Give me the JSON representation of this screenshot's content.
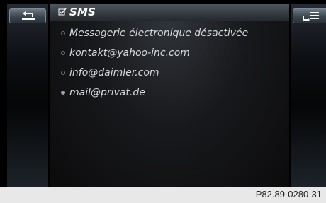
{
  "header": {
    "title": "SMS",
    "check_icon": "checkbox-checked-icon"
  },
  "left_button": {
    "icon": "back-arrow-icon"
  },
  "right_button": {
    "icon": "menu-submenu-icon"
  },
  "items": [
    {
      "label": "Messagerie électronique désactivée",
      "selected": false
    },
    {
      "label": "kontakt@yahoo-inc.com",
      "selected": false
    },
    {
      "label": "info@daimler.com",
      "selected": false
    },
    {
      "label": "mail@privat.de",
      "selected": true
    }
  ],
  "footer": {
    "code": "P82.89-0280-31"
  }
}
